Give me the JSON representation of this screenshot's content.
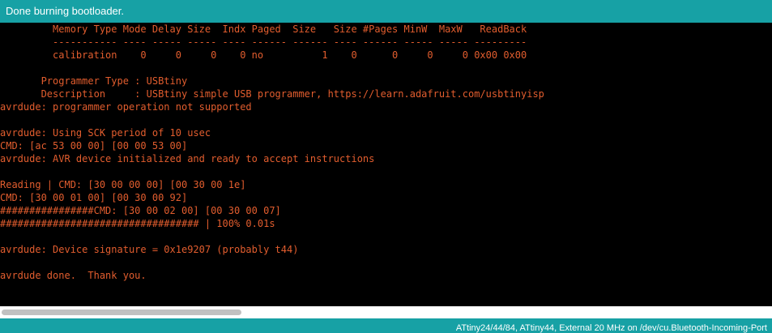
{
  "status_header": {
    "message": "Done burning bootloader."
  },
  "console": {
    "text_color": "#e25d2e",
    "lines": [
      "         Memory Type Mode Delay Size  Indx Paged  Size   Size #Pages MinW  MaxW   ReadBack",
      "         ----------- ---- ----- ----- ---- ------ ------ ---- ------ ----- ----- ---------",
      "         calibration    0     0     0    0 no          1    0      0     0     0 0x00 0x00",
      "",
      "       Programmer Type : USBtiny",
      "       Description     : USBtiny simple USB programmer, https://learn.adafruit.com/usbtinyisp",
      "avrdude: programmer operation not supported",
      "",
      "avrdude: Using SCK period of 10 usec",
      "CMD: [ac 53 00 00] [00 00 53 00]",
      "avrdude: AVR device initialized and ready to accept instructions",
      "",
      "Reading | CMD: [30 00 00 00] [00 30 00 1e]",
      "CMD: [30 00 01 00] [00 30 00 92]",
      "################CMD: [30 00 02 00] [00 30 00 07]",
      "################################## | 100% 0.01s",
      "",
      "avrdude: Device signature = 0x1e9207 (probably t44)",
      "",
      "avrdude done.  Thank you.",
      ""
    ]
  },
  "footer": {
    "board_info": "ATtiny24/44/84, ATtiny44, External 20 MHz on /dev/cu.Bluetooth-Incoming-Port"
  },
  "colors": {
    "accent_teal": "#17a1a5",
    "console_background": "#000000",
    "console_text": "#e25d2e"
  }
}
